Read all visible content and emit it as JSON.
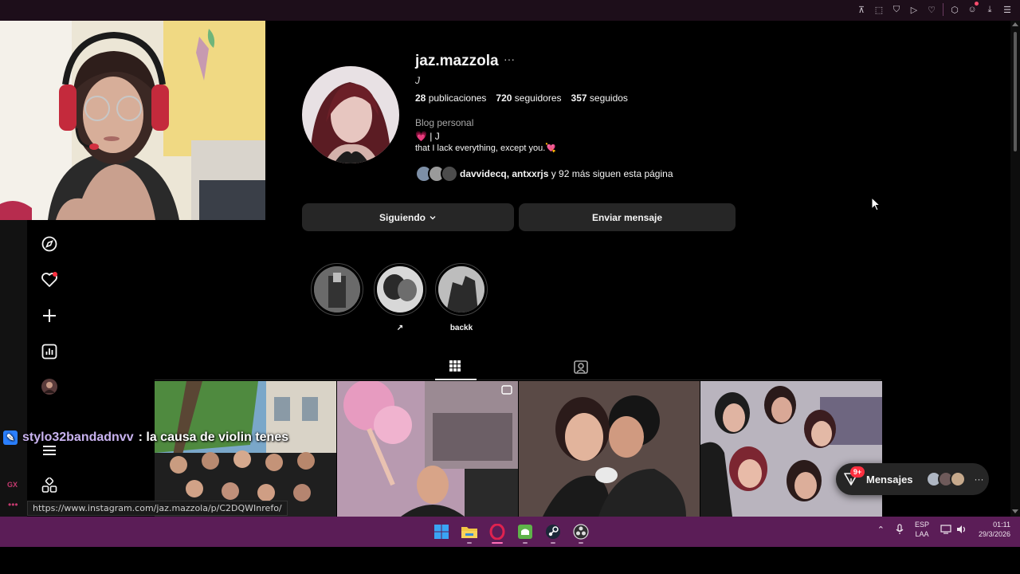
{
  "browser": {
    "toolbar_icons": [
      "pin-icon",
      "screenshot-icon",
      "shield-icon",
      "play-icon",
      "heart-icon",
      "extensions-icon",
      "profile-icon",
      "download-icon",
      "menu-icon"
    ]
  },
  "profile": {
    "username": "jaz.mazzola",
    "more_label": "···",
    "display_name": "J",
    "stats": {
      "posts_count": "28",
      "posts_label": "publicaciones",
      "followers_count": "720",
      "followers_label": "seguidores",
      "following_count": "357",
      "following_label": "seguidos"
    },
    "category": "Blog personal",
    "bio_line1": "💗 | J",
    "bio_line2": "that I lack everything, except you.💘",
    "followed_by_names": "davvidecq, antxxrjs",
    "followed_by_rest": " y 92 más siguen esta página"
  },
  "actions": {
    "following_label": "Siguiendo",
    "message_label": "Enviar mensaje"
  },
  "highlights": [
    {
      "label": ""
    },
    {
      "label": "↗"
    },
    {
      "label": "backk"
    }
  ],
  "chat": {
    "user": "stylo32bandadnvv",
    "message": ": la causa de violin tenes"
  },
  "status_url": "https://www.instagram.com/jaz.mazzola/p/C2DQWInrefo/",
  "sidebar": {
    "gx_label": "GX",
    "more_dots": "•••"
  },
  "messages_widget": {
    "label": "Mensajes",
    "badge": "9+",
    "more": "···"
  },
  "taskbar": {
    "apps": [
      "windows-start-icon",
      "file-explorer-icon",
      "opera-gx-icon",
      "android-app-icon",
      "steam-icon",
      "obs-icon"
    ],
    "language": "ESP",
    "layout": "LAA",
    "time": "01:11",
    "date": "29/3/2026"
  },
  "colors": {
    "background": "#000000",
    "button": "#262626",
    "taskbar": "#5b1d57",
    "chat_user": "#c9b3f0",
    "notification": "#ff3040"
  }
}
